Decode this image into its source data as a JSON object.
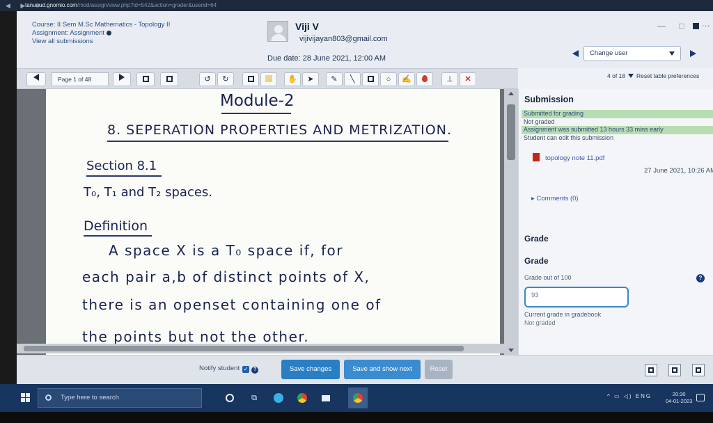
{
  "browser": {
    "host": "tanuaud.gnomio.com",
    "path": "/mod/assign/view.php?id=542&action=grader&userid=64"
  },
  "header": {
    "course": "Course: II Sem M.Sc Mathematics - Topology II",
    "assignment": "Assignment: Assignment",
    "view_all": "View all submissions",
    "user_name": "Viji V",
    "user_email": "vijivijayan803@gmail.com",
    "due_date": "Due date: 28 June 2021, 12:00 AM",
    "change_user": "Change user",
    "counter": "4 of 18",
    "reset_prefs": "Reset table preferences"
  },
  "toolbar": {
    "page_label": "Page 1 of 48",
    "tools": [
      "undo-icon",
      "redo-icon",
      "stamp-icon",
      "highlight-icon",
      "pan-icon",
      "select-icon",
      "comment-icon",
      "line-icon",
      "rectangle-icon",
      "oval-icon",
      "pen-icon",
      "color-icon",
      "user-stamp-icon",
      "delete-icon"
    ]
  },
  "document": {
    "module_title": "Module-2",
    "chapter_title": "8. SEPERATION PROPERTIES AND METRIZATION.",
    "section": "Section 8.1",
    "spaces": "T₀, T₁ and T₂ spaces.",
    "definition": "Definition",
    "lines": [
      "A space X is a T₀ space if, for",
      "each pair a,b of distinct points of X,",
      "there is an openset containing one of",
      "the points but not the other."
    ]
  },
  "submission": {
    "title": "Submission",
    "statuses": [
      {
        "text": "Submitted for grading",
        "highlight": true
      },
      {
        "text": "Not graded",
        "highlight": false
      },
      {
        "text": "Assignment was submitted 13 hours 33 mins early",
        "highlight": true
      },
      {
        "text": "Student can edit this submission",
        "highlight": false
      }
    ],
    "file_name": "topology note 11.pdf",
    "file_time": "27 June 2021, 10:26 AM",
    "comments": "Comments (0)"
  },
  "grade": {
    "heading": "Grade",
    "subheading": "Grade",
    "out_of": "Grade out of 100",
    "value": "93",
    "current_label": "Current grade in gradebook",
    "current_value": "Not graded"
  },
  "actions": {
    "notify": "Notify student",
    "save": "Save changes",
    "save_next": "Save and show next",
    "reset": "Reset"
  },
  "taskbar": {
    "search_placeholder": "Type here to search",
    "tray": "ENG",
    "time": "20:30",
    "date": "04-01-2023"
  },
  "colors": {
    "accent": "#2a7fc4",
    "highlight_green": "#b8ddb2",
    "taskbar": "#17355e"
  }
}
